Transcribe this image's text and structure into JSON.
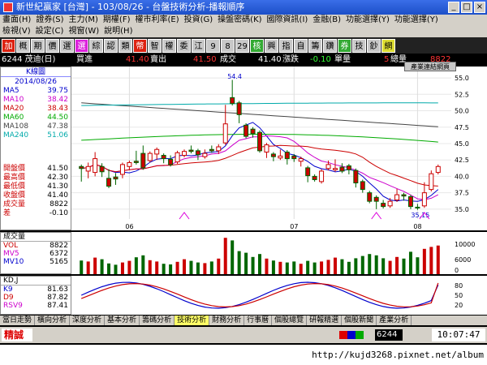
{
  "window": {
    "title": "新世紀贏家 [台灣] - 103/08/26 - 台盤技術分析-播報順序"
  },
  "menu": {
    "row1": [
      "畫面(H)",
      "證券(S)",
      "主力(M)",
      "期權(F)",
      "權市利率(E)",
      "投資(G)",
      "操盤密碼(K)",
      "國際資訊(I)",
      "金融(B)",
      "功能選擇(Y)",
      "功能選擇(Y)"
    ],
    "row2": [
      "檢視(V)",
      "設定(C)",
      "視窗(W)",
      "說明(H)"
    ]
  },
  "toolbar": {
    "buttons": [
      "加",
      "概",
      "期",
      "價",
      "選",
      "選",
      "綜",
      "認",
      "類",
      "幣",
      "智",
      "權",
      "委",
      "江",
      "9",
      "8",
      "29",
      "核",
      "興",
      "指",
      "自",
      "籌",
      "鑽",
      "券",
      "技",
      "鈔",
      "網"
    ]
  },
  "quote": {
    "stock": "6244 茂迪(日)",
    "buy_label": "買進",
    "buy_price": "41.40",
    "sell_label": "賣出",
    "sell_price": "41.50",
    "trade_label": "成交",
    "trade_price": "41.40",
    "change_label": "漲跌",
    "change_value": "-0.10",
    "volume_label": "單量",
    "volume_value": "5",
    "total_label": "總量",
    "total_value": "8822",
    "tooltip": "產業連結網頁"
  },
  "left_panel": {
    "header": "K線圖",
    "date": "2014/08/26",
    "ma": [
      {
        "name": "MA5",
        "value": "39.75",
        "color": "#0000cc"
      },
      {
        "name": "MA10",
        "value": "38.42",
        "color": "#cc00cc"
      },
      {
        "name": "MA20",
        "value": "38.43",
        "color": "#cc0000"
      },
      {
        "name": "MA60",
        "value": "44.50",
        "color": "#00aa00"
      },
      {
        "name": "MA108",
        "value": "47.38",
        "color": "#444444"
      },
      {
        "name": "MA240",
        "value": "51.06",
        "color": "#00aaaa"
      }
    ],
    "ohlc": [
      {
        "name": "開盤價",
        "value": "41.50"
      },
      {
        "name": "最高價",
        "value": "42.30"
      },
      {
        "name": "最低價",
        "value": "41.30"
      },
      {
        "name": "收盤價",
        "value": "41.40"
      },
      {
        "name": "成交量",
        "value": "8822"
      },
      {
        "name": "差",
        "value": "-0.10"
      }
    ]
  },
  "vol_panel": {
    "title": "成交量",
    "rows": [
      {
        "name": "VOL",
        "value": "8822",
        "color": "#cc0000"
      },
      {
        "name": "MV5",
        "value": "6372",
        "color": "#cc00cc"
      },
      {
        "name": "MV10",
        "value": "5165",
        "color": "#0000cc"
      }
    ],
    "axis": [
      "10000",
      "6000",
      "0"
    ]
  },
  "kd_panel": {
    "title": "KD,J",
    "rows": [
      {
        "name": "K9",
        "value": "81.63",
        "color": "#0000cc"
      },
      {
        "name": "D9",
        "value": "87.82",
        "color": "#cc0000"
      },
      {
        "name": "RSV9",
        "value": "87.41",
        "color": "#cc00cc"
      }
    ],
    "axis": [
      "80",
      "50",
      "20"
    ]
  },
  "tabs": [
    "當日走勢",
    "橫向分析",
    "深度分析",
    "基本分析",
    "籌碼分析",
    "技術分析",
    "財務分析",
    "行事曆",
    "個股總覽",
    "研報精選",
    "個股新聞",
    "產業分析"
  ],
  "active_tab": "技術分析",
  "status": {
    "left": "精誠",
    "code": "6244",
    "clock": "10:07:47"
  },
  "watermark": "http://kujd3268.pixnet.net/album",
  "chart_data": {
    "type": "candlestick",
    "price_axis_ticks": [
      "55.0",
      "52.5",
      "50.0",
      "47.5",
      "45.0",
      "42.5",
      "40.0",
      "37.5",
      "35.0"
    ],
    "ylim": [
      33.5,
      56.0
    ],
    "x_ticks": [
      "06",
      "07",
      "08"
    ],
    "annotations": [
      "54.4",
      "35.15"
    ],
    "candles": [
      [
        41.5,
        41.2,
        40.9,
        39.5
      ],
      [
        40.8,
        41.5,
        40.0,
        41.8
      ],
      [
        40.6,
        42.7,
        40.3,
        43.4
      ],
      [
        41.5,
        40.7,
        40.2,
        41.7
      ],
      [
        39.7,
        38.5,
        40.5,
        40.8
      ],
      [
        39.9,
        39.6,
        39.0,
        40.2
      ],
      [
        40.3,
        41.8,
        40.0,
        41.6
      ],
      [
        41.5,
        42.1,
        41.4,
        41.3
      ],
      [
        42.3,
        42.1,
        43.0,
        43.6
      ],
      [
        43.5,
        41.3,
        43.8,
        44.4
      ],
      [
        42.4,
        43.5,
        43.0,
        43.4
      ],
      [
        43.4,
        44.1,
        42.8,
        43.6
      ],
      [
        43.2,
        42.7,
        43.2,
        42.3
      ],
      [
        42.6,
        41.8,
        42.9,
        42.6
      ],
      [
        42.2,
        43.6,
        42.6,
        43.1
      ],
      [
        43.2,
        43.8,
        43.2,
        43.7
      ],
      [
        44.0,
        43.8,
        43.8,
        44.4
      ],
      [
        43.9,
        43.3,
        43.2,
        42.8
      ],
      [
        43.0,
        43.5,
        43.2,
        43.8
      ],
      [
        44.1,
        43.9,
        44.4,
        43.9
      ],
      [
        43.9,
        44.5,
        43.7,
        44.6
      ],
      [
        45.1,
        48.0,
        50.6,
        50.1
      ],
      [
        52.0,
        51.1,
        54.4,
        51.2
      ],
      [
        51.2,
        49.4,
        50.0,
        48.4
      ],
      [
        47.8,
        46.1,
        47.4,
        47.0
      ],
      [
        47.2,
        46.5,
        46.2,
        46.4
      ],
      [
        46.7,
        43.9,
        44.0,
        44.2
      ],
      [
        43.7,
        44.8,
        43.1,
        43.9
      ],
      [
        43.4,
        43.0,
        42.7,
        42.6
      ],
      [
        42.8,
        43.1,
        43.8,
        43.7
      ],
      [
        43.7,
        42.7,
        43.2,
        42.1
      ],
      [
        43.1,
        42.7,
        43.0,
        42.5
      ],
      [
        42.3,
        42.7,
        42.0,
        41.8
      ],
      [
        41.3,
        40.1,
        40.3,
        39.4
      ],
      [
        40.0,
        39.5,
        39.6,
        39.7
      ],
      [
        39.2,
        40.8,
        39.8,
        40.2
      ],
      [
        41.2,
        41.8,
        41.3,
        42.1
      ],
      [
        41.0,
        41.2,
        41.4,
        42.3
      ],
      [
        41.4,
        40.8,
        41.7,
        40.9
      ],
      [
        41.6,
        41.0,
        41.0,
        40.6
      ],
      [
        40.9,
        39.0,
        38.6,
        39.0
      ],
      [
        39.2,
        38.0,
        37.8,
        38.0
      ],
      [
        37.5,
        36.2,
        36.8,
        36.6
      ],
      [
        36.8,
        36.2,
        35.3,
        35.5
      ],
      [
        35.9,
        35.4,
        36.1,
        35.6
      ],
      [
        35.5,
        36.2,
        36.4,
        35.9
      ],
      [
        36.4,
        37.2,
        37.8,
        37.0
      ],
      [
        37.2,
        37.0,
        36.6,
        36.8
      ],
      [
        36.9,
        35.4,
        35.3,
        35.5
      ],
      [
        35.3,
        35.2,
        35.3,
        35.5
      ],
      [
        35.5,
        37.5,
        37.9,
        38.8
      ],
      [
        38.0,
        40.4,
        39.1,
        40.6
      ],
      [
        40.6,
        41.5,
        40.7,
        41.4
      ]
    ],
    "kd_range": [
      0,
      100
    ]
  }
}
